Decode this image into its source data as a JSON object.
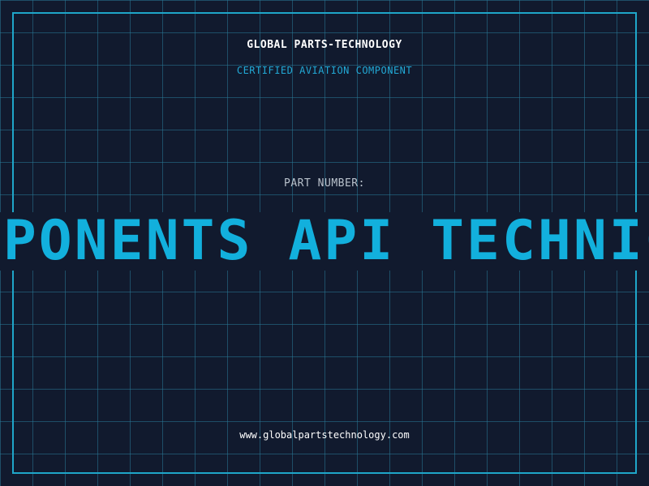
{
  "certificate": {
    "company_name": "GLOBAL PARTS-TECHNOLOGY",
    "subtitle": "CERTIFIED AVIATION COMPONENT",
    "part_number_label": "PART NUMBER:",
    "part_number_value": "COMPONENTS API TECHNICAL",
    "website": "www.globalpartstechnology.com"
  },
  "colors": {
    "background": "#111a2e",
    "grid": "#287896",
    "frame": "#1fa6c9",
    "accent": "#12b0dd",
    "subtitle": "#22a9d6",
    "label": "#b9c2cc",
    "text": "#ffffff"
  }
}
